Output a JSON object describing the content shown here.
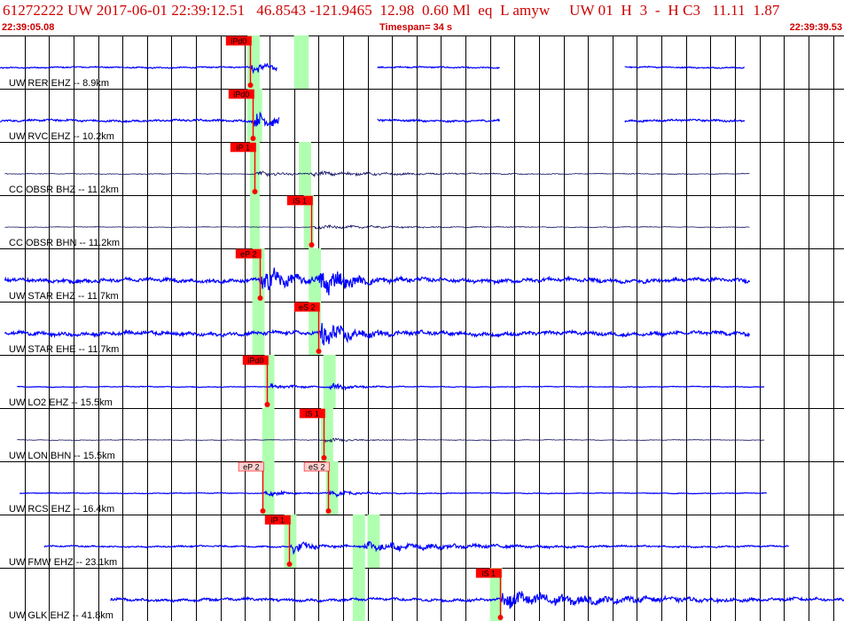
{
  "header": {
    "title": "61272222 UW 2017-06-01 22:39:12.51   46.8543 -121.9465  12.98  0.60 Ml  eq  L amyw     UW 01  H  3  -  H C3   11.11  1.87",
    "start_time": "22:39:05.08",
    "timespan": "Timespan=  34 s",
    "end_time": "22:39:39.53"
  },
  "colors": {
    "header_text": "#cc0000",
    "grid": "#000000",
    "trace_blue": "#0000ff",
    "trace_dark": "#101060",
    "window": "#b0ffb0",
    "pick": "#ff0000",
    "pick_label_red": "#ff0000",
    "pick_label_pink": "#ffd0d0"
  },
  "chart_data": {
    "type": "seismogram",
    "time_range_s": [
      0,
      34.45
    ],
    "grid_interval_s": 1,
    "traces": [
      {
        "label": "UW RER EHZ -- 8.9km",
        "color": "blue",
        "amp": 0.18,
        "segments": [
          [
            0,
            11.3
          ],
          [
            15.4,
            20.4
          ],
          [
            25.5,
            30.4
          ]
        ],
        "windows": [
          [
            10.1,
            10.6
          ],
          [
            12.0,
            12.6
          ]
        ],
        "picks": [
          {
            "label": "iPd0",
            "t": 10.2,
            "style": "red",
            "signal": "big"
          }
        ]
      },
      {
        "label": "UW RVC EHZ -- 10.2km",
        "color": "blue",
        "amp": 0.28,
        "segments": [
          [
            0,
            11.4
          ],
          [
            15.4,
            20.4
          ],
          [
            25.5,
            30.4
          ]
        ],
        "windows": [
          [
            10.1,
            10.7
          ]
        ],
        "picks": [
          {
            "label": "iPd0",
            "t": 10.3,
            "style": "red",
            "signal": "big"
          }
        ]
      },
      {
        "label": "CC OBSR BHZ -- 11.2km",
        "color": "dark",
        "amp": 0.1,
        "segments": [
          [
            0.2,
            30.6
          ]
        ],
        "windows": [
          [
            10.2,
            10.6
          ],
          [
            12.2,
            12.7
          ]
        ],
        "picks": [
          {
            "label": "iP 1",
            "t": 10.4,
            "style": "red",
            "signal": "big"
          },
          {
            "label": "",
            "t": 12.6,
            "style": "none",
            "signal": "coda"
          }
        ]
      },
      {
        "label": "CC OBSR BHN -- 11.2km",
        "color": "dark",
        "amp": 0.08,
        "segments": [
          [
            0.2,
            30.6
          ]
        ],
        "windows": [
          [
            10.2,
            10.6
          ],
          [
            12.4,
            12.8
          ]
        ],
        "picks": [
          {
            "label": "iS 1",
            "t": 12.7,
            "style": "red",
            "signal": "coda"
          }
        ]
      },
      {
        "label": "UW STAR EHZ -- 11.7km",
        "color": "blue",
        "amp": 0.52,
        "segments": [
          [
            0.2,
            30.6
          ]
        ],
        "windows": [
          [
            10.3,
            10.8
          ],
          [
            12.6,
            13.1
          ]
        ],
        "picks": [
          {
            "label": "eP 2",
            "t": 10.6,
            "style": "red",
            "signal": "big"
          },
          {
            "label": "",
            "t": 13.0,
            "style": "none",
            "signal": "big"
          }
        ]
      },
      {
        "label": "UW STAR EHE -- 11.7km",
        "color": "blue",
        "amp": 0.52,
        "segments": [
          [
            0.2,
            30.6
          ]
        ],
        "windows": [
          [
            10.3,
            10.8
          ],
          [
            12.6,
            13.1
          ]
        ],
        "picks": [
          {
            "label": "eS 2",
            "t": 13.0,
            "style": "red",
            "signal": "big"
          }
        ]
      },
      {
        "label": "UW LO2 EHZ -- 15.5km",
        "color": "blue",
        "amp": 0.1,
        "segments": [
          [
            0.7,
            31.2
          ]
        ],
        "windows": [
          [
            10.8,
            11.2
          ],
          [
            13.2,
            13.7
          ]
        ],
        "picks": [
          {
            "label": "iPd0",
            "t": 10.9,
            "style": "red",
            "signal": "big"
          },
          {
            "label": "",
            "t": 13.4,
            "style": "none",
            "signal": "big"
          }
        ]
      },
      {
        "label": "UW LON BHN -- 15.5km",
        "color": "dark",
        "amp": 0.08,
        "segments": [
          [
            0.7,
            31.2
          ]
        ],
        "windows": [
          [
            10.7,
            11.2
          ],
          [
            13.1,
            13.6
          ]
        ],
        "picks": [
          {
            "label": "iS 1",
            "t": 13.2,
            "style": "red",
            "signal": "big"
          }
        ]
      },
      {
        "label": "UW RCS EHZ -- 16.4km",
        "color": "blue",
        "amp": 0.1,
        "segments": [
          [
            0.8,
            31.3
          ]
        ],
        "windows": [
          [
            10.7,
            11.2
          ],
          [
            13.3,
            13.8
          ]
        ],
        "picks": [
          {
            "label": "eP 2",
            "t": 10.7,
            "style": "pink",
            "signal": "big"
          },
          {
            "label": "eS 2",
            "t": 13.4,
            "style": "pink",
            "signal": "big"
          }
        ]
      },
      {
        "label": "UW FMW EHZ -- 23.1km",
        "color": "blue",
        "amp": 0.2,
        "segments": [
          [
            1.8,
            32.2
          ]
        ],
        "windows": [
          [
            11.6,
            12.1
          ],
          [
            14.4,
            14.9
          ],
          [
            15.0,
            15.5
          ]
        ],
        "picks": [
          {
            "label": "iP 1",
            "t": 11.8,
            "style": "red",
            "signal": "big"
          },
          {
            "label": "",
            "t": 14.8,
            "style": "none",
            "signal": "coda"
          }
        ]
      },
      {
        "label": "UW GLK EHZ -- 41.8km",
        "color": "blue",
        "amp": 0.38,
        "segments": [
          [
            4.5,
            34.45
          ]
        ],
        "windows": [
          [
            14.4,
            14.9
          ],
          [
            20.0,
            20.5
          ]
        ],
        "picks": [
          {
            "label": "iS 1",
            "t": 20.4,
            "style": "red",
            "signal": "coda"
          }
        ]
      }
    ]
  }
}
